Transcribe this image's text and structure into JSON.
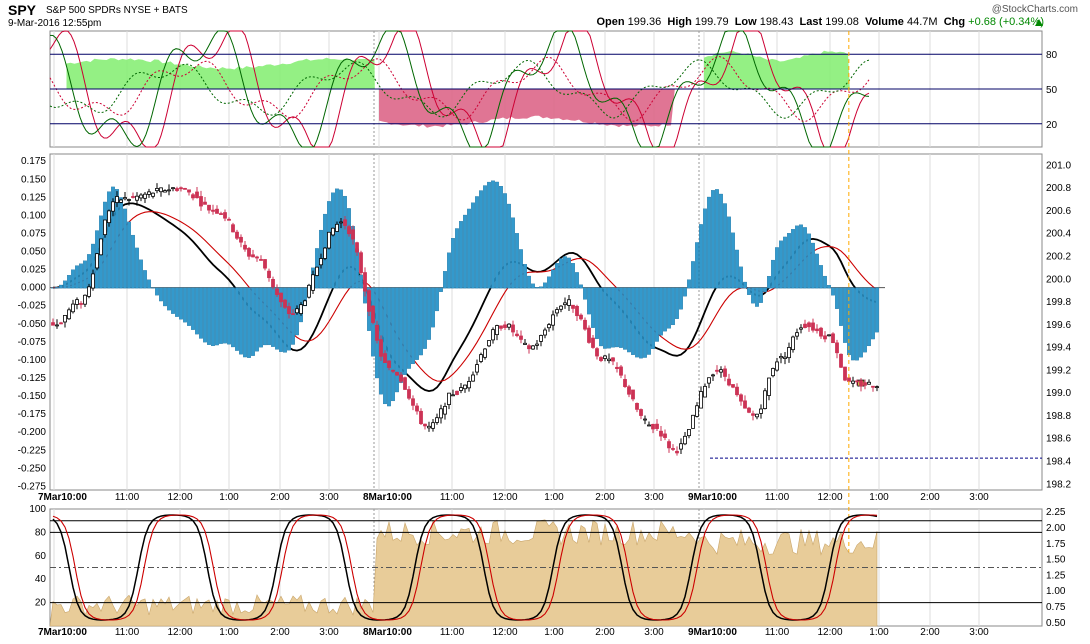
{
  "header": {
    "symbol": "SPY",
    "description": "S&P 500 SPDRs NYSE + BATS",
    "datetime": "9-Mar-2016 12:55pm",
    "copyright": "@StockCharts.com",
    "open_label": "Open",
    "open": "199.36",
    "high_label": "High",
    "high": "199.79",
    "low_label": "Low",
    "low": "198.43",
    "last_label": "Last",
    "last": "199.08",
    "volume_label": "Volume",
    "volume": "44.7M",
    "chg_label": "Chg",
    "chg": "+0.68 (+0.34%)",
    "chg_color": "#008800"
  },
  "chart_data": [
    {
      "type": "line",
      "panel": "top-oscillator",
      "ylim": [
        0,
        100
      ],
      "y_ticks": [
        "80",
        "50",
        "20"
      ],
      "reference_lines": [
        80,
        50,
        20
      ],
      "colors": {
        "fast": "#006600",
        "slow": "#cc0033",
        "fill_up": "#88ee77",
        "fill_down": "#dd6688"
      },
      "zones": [
        {
          "from": "7Mar 10:15",
          "to": "8Mar 9:55",
          "state": "above",
          "level": 72
        },
        {
          "from": "8Mar 10:00",
          "to": "8Mar 3:55",
          "state": "below",
          "level": 22
        },
        {
          "from": "9Mar 10:00",
          "to": "9Mar 12:55",
          "state": "above",
          "level": 78
        }
      ]
    },
    {
      "type": "bar",
      "panel": "price-macd",
      "left_axis_ticks": [
        "0.175",
        "0.150",
        "0.125",
        "0.100",
        "0.075",
        "0.050",
        "0.025",
        "0.000",
        "-0.025",
        "-0.050",
        "-0.075",
        "-0.100",
        "-0.125",
        "-0.150",
        "-0.175",
        "-0.200",
        "-0.225",
        "-0.250",
        "-0.275"
      ],
      "right_axis_ticks": [
        "201.0",
        "200.8",
        "200.6",
        "200.4",
        "200.2",
        "200.0",
        "199.8",
        "199.6",
        "199.4",
        "199.2",
        "199.0",
        "198.8",
        "198.6",
        "198.4",
        "198.2"
      ],
      "left_ylim": [
        -0.28,
        0.185
      ],
      "right_ylim": [
        198.15,
        201.1
      ],
      "x_ticks": [
        "7Mar10:00",
        "11:00",
        "12:00",
        "1:00",
        "2:00",
        "3:00",
        "8Mar10:00",
        "11:00",
        "12:00",
        "1:00",
        "2:00",
        "3:00",
        "9Mar10:00",
        "11:00",
        "12:00",
        "1:00",
        "2:00",
        "3:00"
      ],
      "histogram_color": "#3399cc",
      "price_close_keypoints": [
        {
          "t": "7Mar 10:00",
          "v": 199.6
        },
        {
          "t": "7Mar 10:30",
          "v": 199.8
        },
        {
          "t": "7Mar 11:15",
          "v": 200.7
        },
        {
          "t": "7Mar 12:30",
          "v": 200.8
        },
        {
          "t": "7Mar 1:15",
          "v": 200.6
        },
        {
          "t": "7Mar 2:00",
          "v": 200.2
        },
        {
          "t": "7Mar 2:45",
          "v": 199.7
        },
        {
          "t": "7Mar 3:45",
          "v": 200.5
        },
        {
          "t": "8Mar 10:15",
          "v": 199.2
        },
        {
          "t": "8Mar 11:00",
          "v": 198.7
        },
        {
          "t": "8Mar 11:30",
          "v": 199.0
        },
        {
          "t": "8Mar 12:30",
          "v": 199.6
        },
        {
          "t": "8Mar 1:00",
          "v": 199.4
        },
        {
          "t": "8Mar 1:45",
          "v": 199.8
        },
        {
          "t": "8Mar 2:30",
          "v": 199.3
        },
        {
          "t": "8Mar 3:30",
          "v": 198.7
        },
        {
          "t": "8Mar 3:55",
          "v": 198.5
        },
        {
          "t": "9Mar 10:15",
          "v": 199.2
        },
        {
          "t": "9Mar 11:00",
          "v": 198.8
        },
        {
          "t": "9Mar 11:30",
          "v": 199.3
        },
        {
          "t": "9Mar 12:00",
          "v": 199.6
        },
        {
          "t": "9Mar 12:30",
          "v": 199.5
        },
        {
          "t": "9Mar 12:55",
          "v": 199.08
        }
      ],
      "last_price": 199.08,
      "low_line_value": 198.43,
      "series_colors": {
        "macd": "#000000",
        "signal": "#cc0000",
        "up_candle": "#000000",
        "down_candle": "#cc3355"
      }
    },
    {
      "type": "area",
      "panel": "bottom-stochastic",
      "left_ticks": [
        "100",
        "80",
        "60",
        "40",
        "20"
      ],
      "right_ticks": [
        "2.25",
        "2.00",
        "1.75",
        "1.50",
        "1.25",
        "1.00",
        "0.75",
        "0.50"
      ],
      "left_ylim": [
        0,
        100
      ],
      "right_ylim": [
        0.45,
        2.3
      ],
      "x_ticks": [
        "7Mar10:00",
        "11:00",
        "12:00",
        "1:00",
        "2:00",
        "3:00",
        "8Mar10:00",
        "11:00",
        "12:00",
        "1:00",
        "2:00",
        "3:00",
        "9Mar10:00",
        "11:00",
        "12:00",
        "1:00",
        "2:00",
        "3:00"
      ],
      "reference_lines": [
        90,
        80,
        50,
        20
      ],
      "area_color": "#e8cc99",
      "series_colors": {
        "k": "#000000",
        "d": "#cc0000"
      }
    }
  ]
}
